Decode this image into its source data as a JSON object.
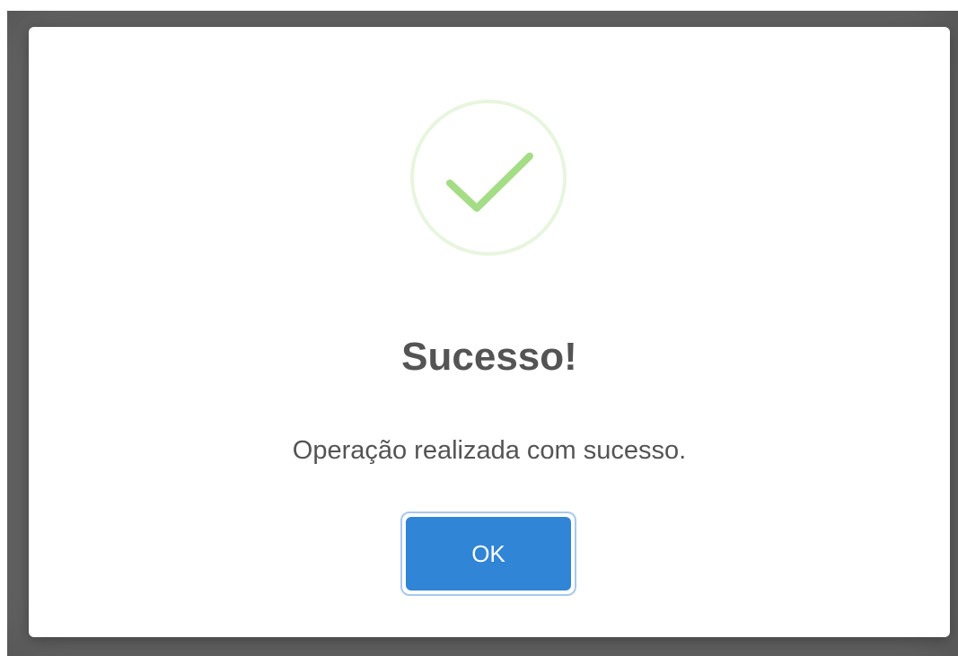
{
  "dialog": {
    "icon": "success-check-icon",
    "title": "Sucesso!",
    "message": "Operação realizada com sucesso.",
    "confirm_label": "OK"
  },
  "colors": {
    "overlay": "#6b6b6b",
    "success_green": "#a5dc86",
    "success_ring": "#e8f5df",
    "text": "#545454",
    "button": "#3085d6",
    "button_focus": "#a9c8ec"
  }
}
